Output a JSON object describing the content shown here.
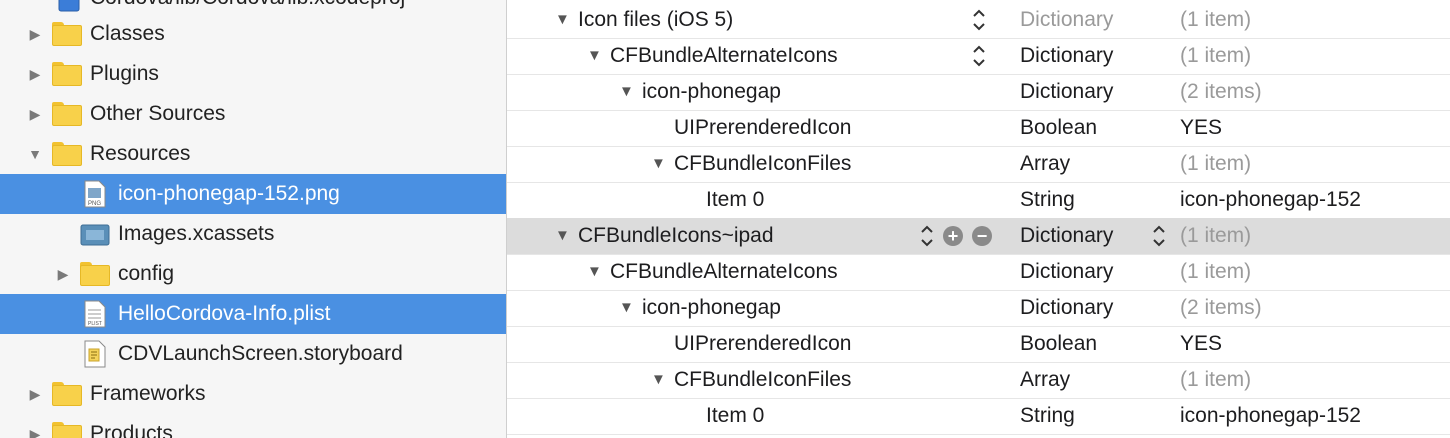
{
  "navigator": {
    "top_partial_label": "Cordova/lib/Cordova/lib.xcodeproj",
    "items": [
      {
        "label": "Classes",
        "expanded": false,
        "selected": false
      },
      {
        "label": "Plugins",
        "expanded": false,
        "selected": false
      },
      {
        "label": "Other Sources",
        "expanded": false,
        "selected": false
      },
      {
        "label": "Resources",
        "expanded": true,
        "selected": false
      },
      {
        "label": "icon-phonegap-152.png",
        "selected": true,
        "icon": "png-file-icon"
      },
      {
        "label": "Images.xcassets",
        "selected": false,
        "icon": "asset-catalog-icon"
      },
      {
        "label": "config",
        "expanded": false,
        "selected": false
      },
      {
        "label": "HelloCordova-Info.plist",
        "selected": true,
        "icon": "plist-file-icon"
      },
      {
        "label": "CDVLaunchScreen.storyboard",
        "selected": false,
        "icon": "storyboard-file-icon"
      },
      {
        "label": "Frameworks",
        "expanded": false,
        "selected": false
      },
      {
        "label": "Products",
        "expanded": false,
        "selected": false
      }
    ]
  },
  "plist": {
    "rows": [
      {
        "key": "Icon files (iOS 5)",
        "type": "Dictionary",
        "value": "(1 item)"
      },
      {
        "key": "CFBundleAlternateIcons",
        "type": "Dictionary",
        "value": "(1 item)"
      },
      {
        "key": "icon-phonegap",
        "type": "Dictionary",
        "value": "(2 items)"
      },
      {
        "key": "UIPrerenderedIcon",
        "type": "Boolean",
        "value": "YES"
      },
      {
        "key": "CFBundleIconFiles",
        "type": "Array",
        "value": "(1 item)"
      },
      {
        "key": "Item 0",
        "type": "String",
        "value": "icon-phonegap-152"
      },
      {
        "key": "CFBundleIcons~ipad",
        "type": "Dictionary",
        "value": "(1 item)"
      },
      {
        "key": "CFBundleAlternateIcons",
        "type": "Dictionary",
        "value": "(1 item)"
      },
      {
        "key": "icon-phonegap",
        "type": "Dictionary",
        "value": "(2 items)"
      },
      {
        "key": "UIPrerenderedIcon",
        "type": "Boolean",
        "value": "YES"
      },
      {
        "key": "CFBundleIconFiles",
        "type": "Array",
        "value": "(1 item)"
      },
      {
        "key": "Item 0",
        "type": "String",
        "value": "icon-phonegap-152"
      }
    ]
  },
  "colors": {
    "selection": "#4a90e2",
    "row_highlight": "#dcdcdc",
    "folder": "#f8d14a"
  }
}
